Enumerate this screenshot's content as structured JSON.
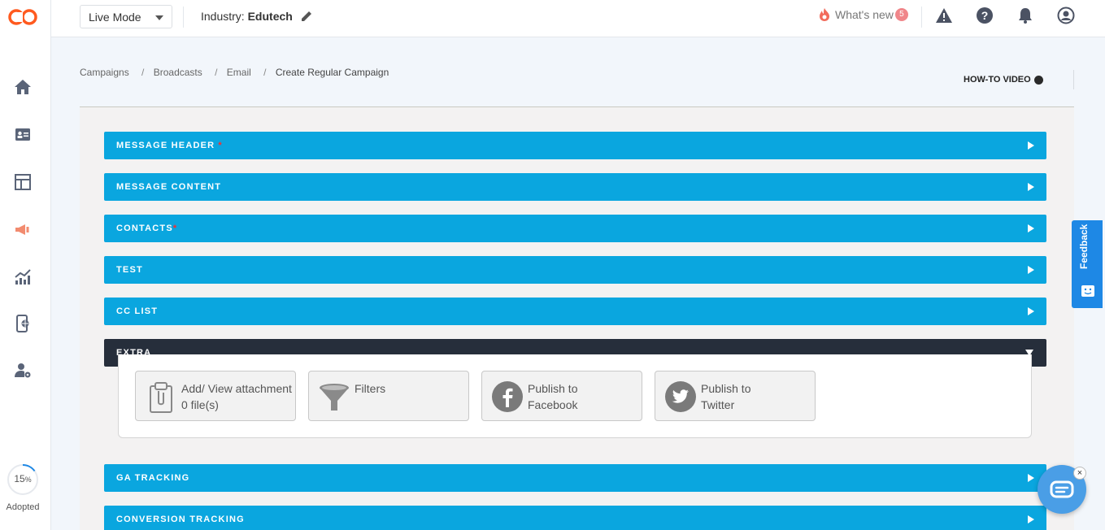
{
  "topbar": {
    "mode_value": "Live Mode",
    "industry_label": "Industry:",
    "industry_value": "Edutech",
    "whats_new_label": "What's new",
    "whats_new_count": "5"
  },
  "sidebar": {
    "items": [
      "home-icon",
      "contacts-card-icon",
      "layout-icon",
      "megaphone-icon",
      "analytics-icon",
      "mobile-web-icon",
      "user-settings-icon"
    ],
    "adoption_percent": "15",
    "adoption_unit": "%",
    "adoption_label": "Adopted",
    "adoption_fraction": 0.15
  },
  "breadcrumb": {
    "items": [
      "Campaigns",
      "Broadcasts",
      "Email",
      "Create Regular Campaign"
    ],
    "separator": "/"
  },
  "howto_label": "HOW-TO VIDEO",
  "accordion": [
    {
      "label": "MESSAGE HEADER",
      "required": "*",
      "expanded": false
    },
    {
      "label": "MESSAGE CONTENT",
      "required": "",
      "expanded": false
    },
    {
      "label": "CONTACTS",
      "required": "*",
      "expanded": false
    },
    {
      "label": "TEST",
      "required": "",
      "expanded": false
    },
    {
      "label": "CC LIST",
      "required": "",
      "expanded": false
    },
    {
      "label": "EXTRA",
      "required": "",
      "expanded": true
    },
    {
      "label": "GA TRACKING",
      "required": "",
      "expanded": false
    },
    {
      "label": "CONVERSION TRACKING",
      "required": "",
      "expanded": false
    }
  ],
  "extra_tiles": [
    {
      "line1": "Add/ View attachment",
      "line2": "0 file(s)",
      "icon": "clipboard-attachment-icon"
    },
    {
      "line1": "Filters",
      "line2": "",
      "icon": "funnel-icon"
    },
    {
      "line1": "Publish to",
      "line2": "Facebook",
      "icon": "facebook-icon"
    },
    {
      "line1": "Publish to",
      "line2": "Twitter",
      "icon": "twitter-icon"
    }
  ],
  "feedback_label": "Feedback",
  "colors": {
    "accent": "#0aa6df",
    "dark": "#262e3b",
    "feedback": "#1e88e5",
    "chat": "#4a9ee6"
  }
}
